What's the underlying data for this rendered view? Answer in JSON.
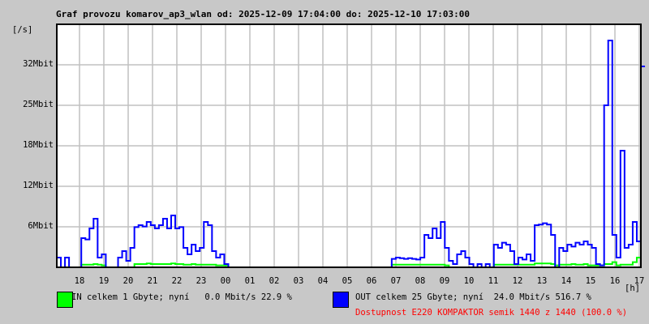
{
  "title": "Graf provozu komarov_ap3_wlan od: 2025-12-09 17:04:00 do: 2025-12-10 17:03:00",
  "chart_data": {
    "type": "line",
    "title": "Graf provozu komarov_ap3_wlan od: 2025-12-09 17:04:00 do: 2025-12-10 17:03:00",
    "ylabel": "[/s]",
    "xlabel": "[h]",
    "y_unit": "Mbit/s",
    "ylim": [
      0,
      37.5
    ],
    "y_ticks": [
      {
        "value": 6.25,
        "label": "6Mbit"
      },
      {
        "value": 12.5,
        "label": "12Mbit"
      },
      {
        "value": 18.75,
        "label": "18Mbit"
      },
      {
        "value": 25,
        "label": "25Mbit"
      },
      {
        "value": 31.25,
        "label": "32Mbit"
      }
    ],
    "x_start_hour": 17.0667,
    "x_step_minutes": 10,
    "x_ticks": [
      "18",
      "19",
      "20",
      "21",
      "22",
      "23",
      "00",
      "01",
      "02",
      "03",
      "04",
      "05",
      "06",
      "07",
      "08",
      "09",
      "10",
      "11",
      "12",
      "13",
      "14",
      "15",
      "16",
      "17"
    ],
    "grid": true,
    "series": [
      {
        "name": "IN",
        "color": "#00ff00",
        "values": [
          0,
          0,
          0,
          0,
          0,
          0,
          0.4,
          0.4,
          0.4,
          0.5,
          0.4,
          0.3,
          0,
          0,
          0,
          0,
          0,
          0,
          0,
          0.5,
          0.5,
          0.5,
          0.6,
          0.5,
          0.5,
          0.5,
          0.5,
          0.5,
          0.6,
          0.5,
          0.5,
          0.4,
          0.4,
          0.5,
          0.4,
          0.4,
          0.4,
          0.4,
          0.4,
          0.3,
          0.3,
          0.3,
          0,
          0,
          0,
          0,
          0,
          0,
          0,
          0,
          0,
          0,
          0,
          0,
          0,
          0,
          0,
          0,
          0,
          0,
          0,
          0,
          0,
          0,
          0,
          0,
          0,
          0,
          0,
          0,
          0,
          0,
          0,
          0,
          0,
          0,
          0,
          0,
          0,
          0,
          0,
          0,
          0.4,
          0.4,
          0.4,
          0.4,
          0.4,
          0.4,
          0.4,
          0.4,
          0.4,
          0.4,
          0.4,
          0.4,
          0.4,
          0.3,
          0,
          0,
          0,
          0,
          0,
          0,
          0,
          0,
          0,
          0,
          0,
          0.4,
          0.4,
          0.4,
          0.4,
          0.4,
          0.4,
          0.4,
          0.4,
          0.4,
          0.4,
          0.6,
          0.6,
          0.6,
          0.6,
          0.5,
          0.3,
          0.4,
          0.4,
          0.4,
          0.5,
          0.4,
          0.4,
          0.5,
          0.3,
          0.3,
          0.3,
          0.3,
          0.5,
          0.5,
          0.8,
          0.3,
          0.4,
          0.4,
          0.4,
          0.8,
          1.5
        ]
      },
      {
        "name": "OUT",
        "color": "#0000ff",
        "values": [
          1.5,
          0,
          1.5,
          0,
          0,
          0,
          4.5,
          4.3,
          6,
          7.5,
          1.5,
          2,
          0,
          0,
          0,
          1.5,
          2.5,
          1,
          3,
          6.2,
          6.5,
          6.3,
          7,
          6.5,
          6,
          6.5,
          7.5,
          6,
          8,
          6,
          6.2,
          3,
          2,
          3.5,
          2.5,
          3,
          7,
          6.5,
          2.5,
          1.5,
          2,
          0.5,
          0,
          0,
          0,
          0,
          0,
          0,
          0,
          0,
          0,
          0,
          0,
          0,
          0,
          0,
          0,
          0,
          0,
          0,
          0,
          0,
          0,
          0,
          0,
          0,
          0,
          0,
          0,
          0,
          0,
          0,
          0,
          0,
          0,
          0,
          0,
          0,
          0,
          0,
          0,
          0,
          1.3,
          1.5,
          1.4,
          1.3,
          1.4,
          1.3,
          1.2,
          1.5,
          5,
          4.5,
          6,
          4.5,
          7,
          3,
          1,
          0.5,
          2,
          2.5,
          1.5,
          0.5,
          0,
          0.5,
          0,
          0.5,
          0,
          3.5,
          3,
          3.8,
          3.5,
          2.5,
          0.5,
          1.5,
          1.2,
          2,
          1,
          6.5,
          6.6,
          6.8,
          6.6,
          5,
          0,
          3,
          2.5,
          3.5,
          3.2,
          3.8,
          3.5,
          4,
          3.5,
          3,
          0.5,
          0.3,
          25,
          35,
          5,
          1.5,
          18,
          3,
          3.5,
          7,
          4,
          31
        ]
      }
    ]
  },
  "legend": {
    "in_text": "IN celkem 1 Gbyte; nyní   0.0 Mbit/s 22.9 %",
    "out_text": "OUT celkem 25 Gbyte; nyní  24.0 Mbit/s 516.7 %",
    "availability_text": "Dostupnost E220 KOMPAKTOR semik 1440 z 1440 (100.0 %)",
    "in_color": "#00ff00",
    "out_color": "#0000ff",
    "availability_color": "#ff0000"
  }
}
